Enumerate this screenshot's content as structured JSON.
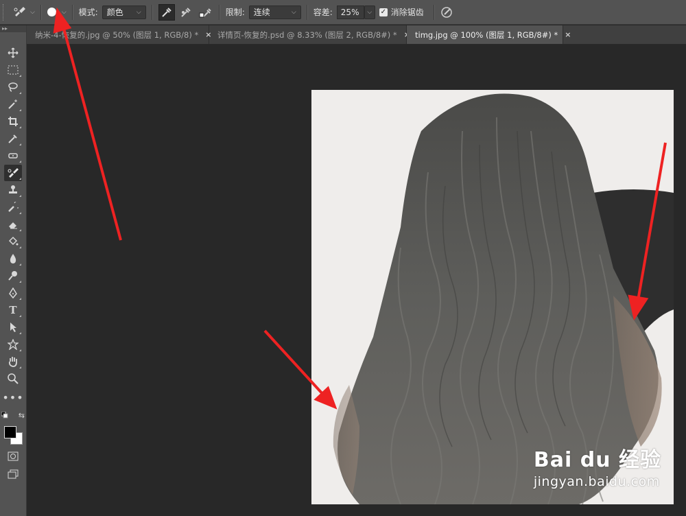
{
  "options_bar": {
    "brush_size_icon": "brush-preset-circle",
    "mode_label": "模式:",
    "mode_value": "颜色",
    "limit_label": "限制:",
    "limit_value": "连续",
    "tolerance_label": "容差:",
    "tolerance_value": "25%",
    "antialias_label": "消除锯齿",
    "antialias_checked": true
  },
  "tabs": [
    {
      "label": "纳米-4-恢复的.jpg @ 50% (图层 1, RGB/8) *",
      "active": false
    },
    {
      "label": "详情页-恢复的.psd @ 8.33% (图层 2, RGB/8#) *",
      "active": false
    },
    {
      "label": "timg.jpg @ 100% (图层 1, RGB/8#) *",
      "active": true
    }
  ],
  "tab_close_glyph": "×",
  "tools": [
    "move-tool",
    "marquee-tool",
    "lasso-tool",
    "magic-wand-tool",
    "crop-tool",
    "eyedropper-tool",
    "healing-brush-tool",
    "color-replacement-tool",
    "clone-stamp-tool",
    "history-brush-tool",
    "eraser-tool",
    "paint-bucket-tool",
    "blur-tool",
    "dodge-tool",
    "pen-tool",
    "type-tool",
    "path-selection-tool",
    "shape-tool",
    "hand-tool",
    "zoom-tool",
    "more-tools"
  ],
  "type_tool_glyph": "T",
  "colors": {
    "foreground": "#000000",
    "background": "#ffffff",
    "annotation_arrow": "#ee2222"
  },
  "watermark": {
    "logo": "Bai du 经验",
    "url": "jingyan.baidu.com"
  }
}
